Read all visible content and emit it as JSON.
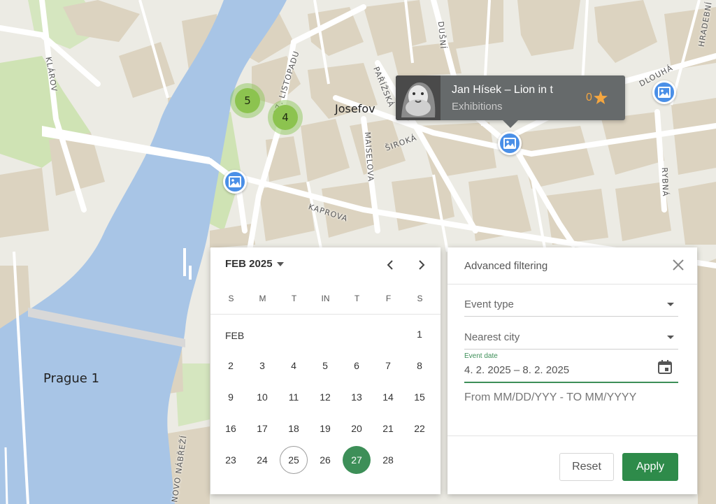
{
  "map": {
    "labels": {
      "josefov": "Josefov",
      "prague1": "Prague 1"
    },
    "streets": {
      "klarov": "KLÁROV",
      "listopadu": "17. LISTOPADU",
      "parizska": "PAŘÍŽSKÁ",
      "dusni": "DUŠNÍ",
      "siroka": "ŠIROKÁ",
      "maiselova": "MAISELOVA",
      "kaprova": "KAPROVA",
      "dlouha": "DLOUHÁ",
      "rybna": "RYBNÁ",
      "hradebni": "HRADEBNÍ",
      "novo_nabrezi": "NOVO NÁBŘEŽÍ"
    },
    "clusters": [
      {
        "count": "5"
      },
      {
        "count": "4"
      }
    ],
    "colors": {
      "water": "#a8c5e6",
      "land": "#ecebe4",
      "block": "#dcd3c0",
      "park": "#cfe3b4",
      "road": "#ffffff",
      "marker": "#4a8fe7",
      "cluster": "#8cc34f"
    }
  },
  "popup": {
    "title": "Jan Hísek – Lion in t",
    "category": "Exhibitions",
    "rating": "0",
    "rating_icon": "star-icon"
  },
  "calendar": {
    "month_label": "FEB 2025",
    "section_label": "FEB",
    "weekdays": [
      "S",
      "M",
      "T",
      "IN",
      "T",
      "F",
      "S"
    ],
    "days": [
      "1",
      "2",
      "3",
      "4",
      "5",
      "6",
      "7",
      "8",
      "9",
      "10",
      "11",
      "12",
      "13",
      "14",
      "15",
      "16",
      "17",
      "18",
      "19",
      "20",
      "21",
      "22",
      "23",
      "24",
      "25",
      "26",
      "27",
      "28"
    ],
    "today": "25",
    "selected": "27"
  },
  "filter": {
    "title": "Advanced filtering",
    "event_type": "Event type",
    "nearest_city": "Nearest city",
    "event_date_label": "Event date",
    "event_date_value": "4. 2. 2025 – 8. 2. 2025",
    "hint": "From MM/DD/YYY - TO MM/YYYY",
    "reset_label": "Reset",
    "apply_label": "Apply",
    "accent": "#2e8b4a"
  }
}
